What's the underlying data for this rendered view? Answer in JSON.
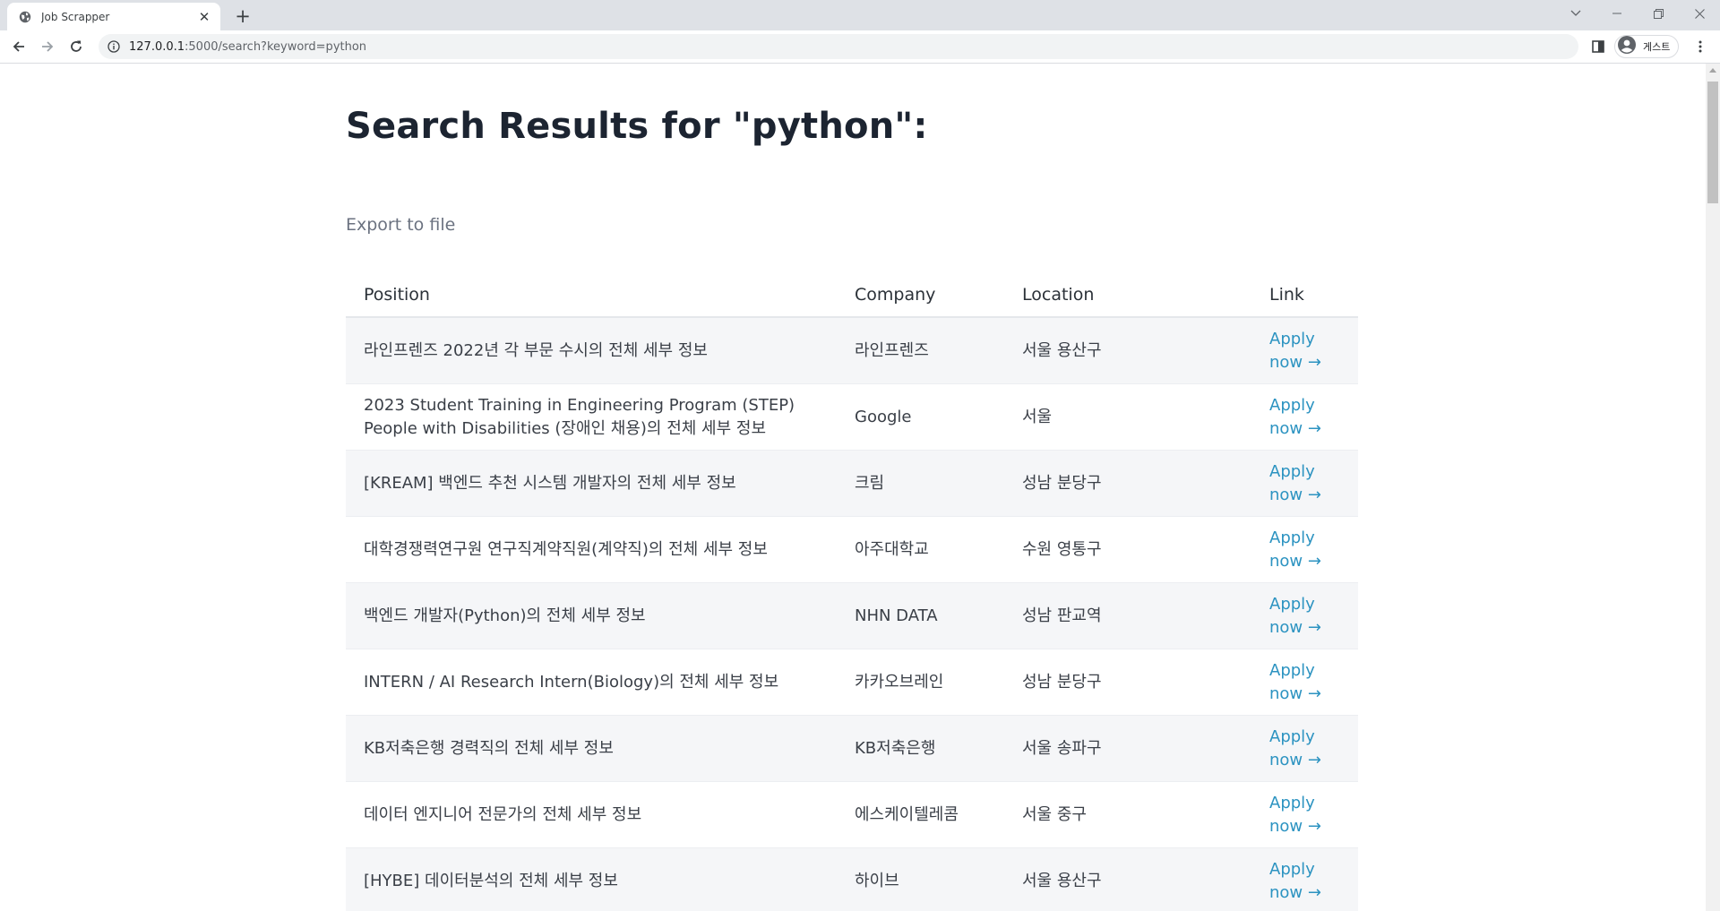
{
  "browser": {
    "tab_title": "Job Scrapper",
    "url_host": "127.0.0.1",
    "url_rest": ":5000/search?keyword=python",
    "profile_label": "게스트"
  },
  "page": {
    "heading": "Search Results for \"python\":",
    "export_label": "Export to file",
    "columns": [
      "Position",
      "Company",
      "Location",
      "Link"
    ],
    "rows": [
      {
        "position": "라인프렌즈 2022년 각 부문 수시의 전체 세부 정보",
        "company": "라인프렌즈",
        "location": "서울 용산구",
        "link": "Apply now →"
      },
      {
        "position": "2023 Student Training in Engineering Program (STEP) People with Disabilities (장애인 채용)의 전체 세부 정보",
        "company": "Google",
        "location": "서울",
        "link": "Apply now →"
      },
      {
        "position": "[KREAM] 백엔드 추천 시스템 개발자의 전체 세부 정보",
        "company": "크림",
        "location": "성남 분당구",
        "link": "Apply now →"
      },
      {
        "position": "대학경쟁력연구원 연구직계약직원(계약직)의 전체 세부 정보",
        "company": "아주대학교",
        "location": "수원 영통구",
        "link": "Apply now →"
      },
      {
        "position": "백엔드 개발자(Python)의 전체 세부 정보",
        "company": "NHN DATA",
        "location": "성남 판교역",
        "link": "Apply now →"
      },
      {
        "position": "INTERN / AI Research Intern(Biology)의 전체 세부 정보",
        "company": "카카오브레인",
        "location": "성남 분당구",
        "link": "Apply now →"
      },
      {
        "position": "KB저축은행 경력직의 전체 세부 정보",
        "company": "KB저축은행",
        "location": "서울 송파구",
        "link": "Apply now →"
      },
      {
        "position": "데이터 엔지니어 전문가의 전체 세부 정보",
        "company": "에스케이텔레콤",
        "location": "서울 중구",
        "link": "Apply now →"
      },
      {
        "position": "[HYBE] 데이터분석의 전체 세부 정보",
        "company": "하이브",
        "location": "서울 용산구",
        "link": "Apply now →"
      }
    ]
  }
}
